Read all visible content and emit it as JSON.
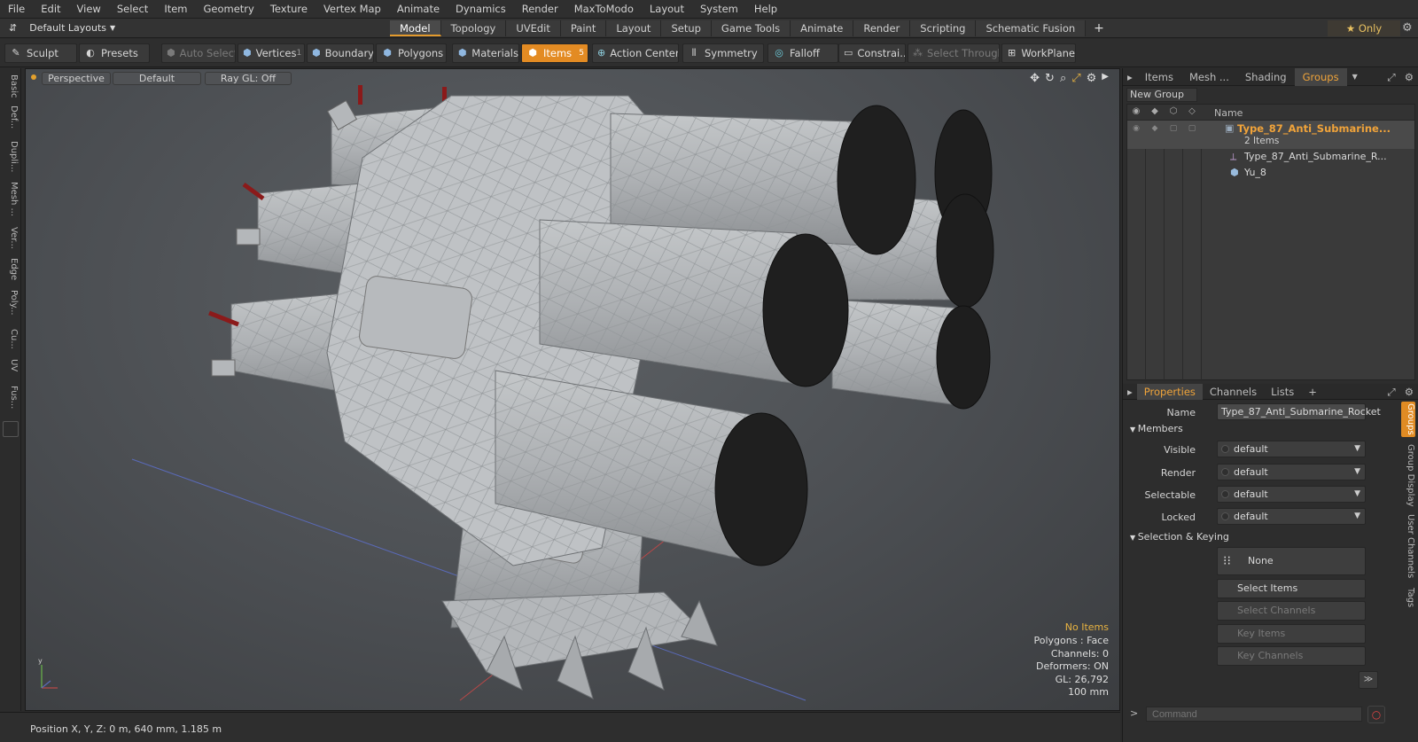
{
  "menu": [
    "File",
    "Edit",
    "View",
    "Select",
    "Item",
    "Geometry",
    "Texture",
    "Vertex Map",
    "Animate",
    "Dynamics",
    "Render",
    "MaxToModo",
    "Layout",
    "System",
    "Help"
  ],
  "layouts_label": "Default Layouts",
  "mode_tabs": [
    {
      "label": "Model",
      "active": true
    },
    {
      "label": "Topology",
      "active": false
    },
    {
      "label": "UVEdit",
      "active": false
    },
    {
      "label": "Paint",
      "active": false
    },
    {
      "label": "Layout",
      "active": false
    },
    {
      "label": "Setup",
      "active": false
    },
    {
      "label": "Game Tools",
      "active": false
    },
    {
      "label": "Animate",
      "active": false
    },
    {
      "label": "Render",
      "active": false
    },
    {
      "label": "Scripting",
      "active": false
    },
    {
      "label": "Schematic Fusion",
      "active": false
    }
  ],
  "only_label": "Only",
  "toolbar": {
    "sculpt": "Sculpt",
    "presets": "Presets",
    "auto_select": "Auto Select",
    "vertices": "Vertices",
    "vertices_num": "1",
    "boundary": "Boundary",
    "polygons": "Polygons",
    "materials": "Materials",
    "items": "Items",
    "items_num": "5",
    "action_center": "Action Center",
    "symmetry": "Symmetry",
    "falloff": "Falloff",
    "constraints": "Constrai...",
    "select_through": "Select Through",
    "workplane": "WorkPlane"
  },
  "left_tabs": [
    "Basic",
    "Def...",
    "Dupli...",
    "Mesh ...",
    "Ver...",
    "Edge",
    "Poly...",
    "Cu...",
    "UV",
    "Fus..."
  ],
  "viewport": {
    "view": "Perspective",
    "shading": "Default",
    "raygl": "Ray GL: Off",
    "info_warn": "No Items",
    "info_lines": [
      "Polygons : Face",
      "Channels: 0",
      "Deformers: ON",
      "GL: 26,792",
      "100 mm"
    ]
  },
  "status": {
    "position": "Position X, Y, Z:   0 m, 640 mm, 1.185 m"
  },
  "right_tabs": [
    {
      "label": "Items",
      "active": false
    },
    {
      "label": "Mesh ...",
      "active": false
    },
    {
      "label": "Shading",
      "active": false
    },
    {
      "label": "Groups",
      "active": true
    }
  ],
  "new_group": "New Group",
  "tree": {
    "name_col": "Name",
    "group": "Type_87_Anti_Submarine...",
    "group_count": "2 Items",
    "items": [
      "Type_87_Anti_Submarine_R...",
      "Yu_8"
    ]
  },
  "prop_tabs": [
    {
      "label": "Properties",
      "active": true
    },
    {
      "label": "Channels",
      "active": false
    },
    {
      "label": "Lists",
      "active": false
    }
  ],
  "props": {
    "name_label": "Name",
    "name_value": "Type_87_Anti_Submarine_Rocket",
    "members": "Members",
    "visible_label": "Visible",
    "visible_value": "default",
    "render_label": "Render",
    "render_value": "default",
    "selectable_label": "Selectable",
    "selectable_value": "default",
    "locked_label": "Locked",
    "locked_value": "default",
    "sel_keying": "Selection & Keying",
    "none": "None",
    "select_items": "Select Items",
    "select_channels": "Select Channels",
    "key_items": "Key Items",
    "key_channels": "Key Channels"
  },
  "right_vtabs": [
    "Groups",
    "Group Display",
    "User Channels",
    "Tags"
  ],
  "command_placeholder": "Command",
  "colors": {
    "accent": "#e38b23",
    "group_text": "#f0a33a",
    "warn": "#e8b341"
  }
}
